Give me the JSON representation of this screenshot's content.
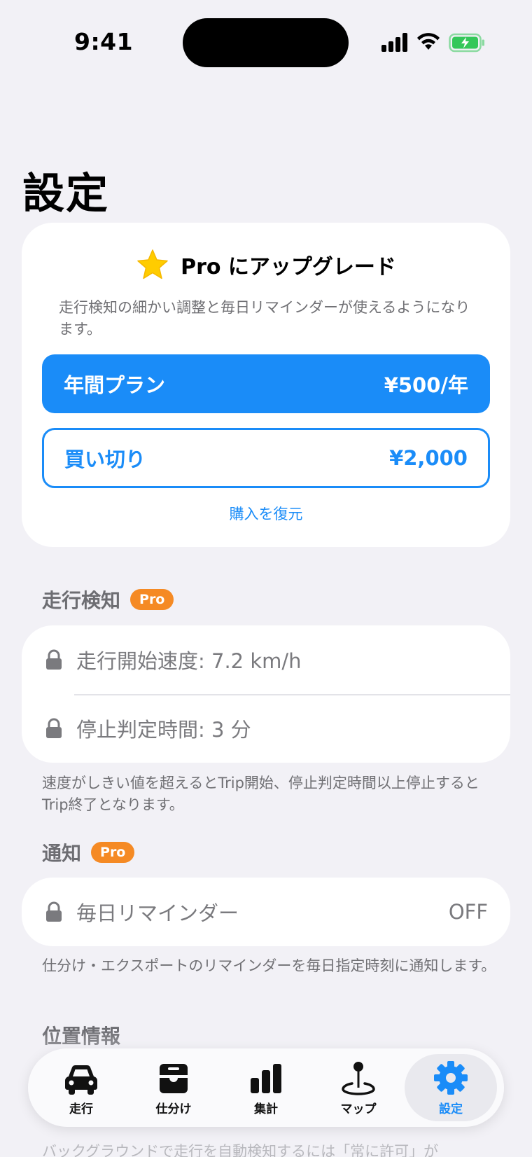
{
  "status_bar": {
    "time": "9:41"
  },
  "page": {
    "title": "設定"
  },
  "upgrade": {
    "icon": "star-icon",
    "title": "Pro にアップグレード",
    "description": "走行検知の細かい調整と毎日リマインダーが使えるようになります。",
    "plans": [
      {
        "label": "年間プラン",
        "price": "¥500/年",
        "selected": true
      },
      {
        "label": "買い切り",
        "price": "¥2,000",
        "selected": false
      }
    ],
    "restore_label": "購入を復元"
  },
  "sections": {
    "detection": {
      "header": "走行検知",
      "badge": "Pro",
      "rows": [
        {
          "label": "走行開始速度: 7.2 km/h",
          "icon": "lock-icon"
        },
        {
          "label": "停止判定時間: 3 分",
          "icon": "lock-icon"
        }
      ],
      "footnote": "速度がしきい値を超えるとTrip開始、停止判定時間以上停止するとTrip終了となります。"
    },
    "notification": {
      "header": "通知",
      "badge": "Pro",
      "rows": [
        {
          "label": "毎日リマインダー",
          "value": "OFF",
          "icon": "lock-icon"
        }
      ],
      "footnote": "仕分け・エクスポートのリマインダーを毎日指定時刻に通知します。"
    },
    "location": {
      "header": "位置情報",
      "partial_text": "バックグラウンドで走行を自動検知するには「常に許可」が"
    }
  },
  "tabbar": {
    "tabs": [
      {
        "label": "走行",
        "icon": "car-icon",
        "active": false
      },
      {
        "label": "仕分け",
        "icon": "tray-icon",
        "active": false
      },
      {
        "label": "集計",
        "icon": "bar-chart-icon",
        "active": false
      },
      {
        "label": "マップ",
        "icon": "map-pin-icon",
        "active": false
      },
      {
        "label": "設定",
        "icon": "gear-icon",
        "active": true
      }
    ]
  },
  "colors": {
    "accent": "#1a8cf8",
    "pro_badge": "#f58a24",
    "star": "#ffcc00",
    "background": "#f2f1f6"
  }
}
